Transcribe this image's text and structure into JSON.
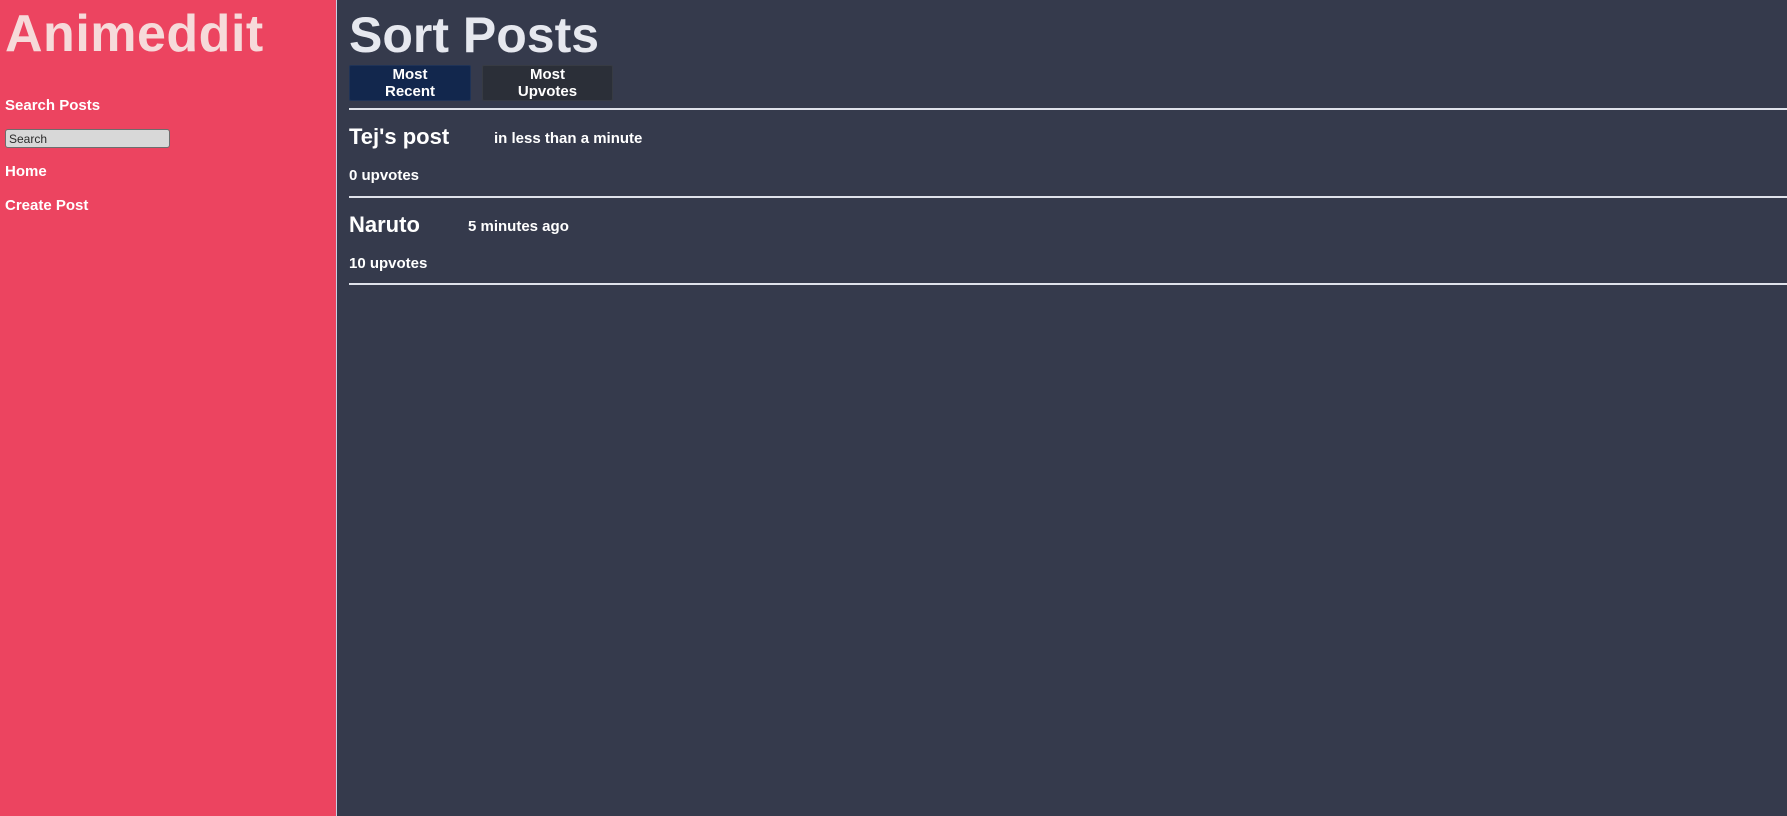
{
  "brand": {
    "title": "Animeddit"
  },
  "nav": {
    "search_posts": "Search Posts",
    "search_placeholder": "Search",
    "home": "Home",
    "create_post": "Create Post"
  },
  "main": {
    "title": "Sort Posts",
    "sort_buttons": {
      "most_recent": "Most Recent",
      "most_upvotes": "Most Upvotes"
    },
    "posts": [
      {
        "title": "Tej's post",
        "time": "in less than a minute",
        "upvotes": "0 upvotes"
      },
      {
        "title": "Naruto",
        "time": "5 minutes ago",
        "upvotes": "10 upvotes"
      }
    ]
  },
  "colors": {
    "sidebar_bg": "#ec4460",
    "main_bg": "#353a4c",
    "active_button": "#12274d",
    "inactive_button": "#2b2f38"
  }
}
